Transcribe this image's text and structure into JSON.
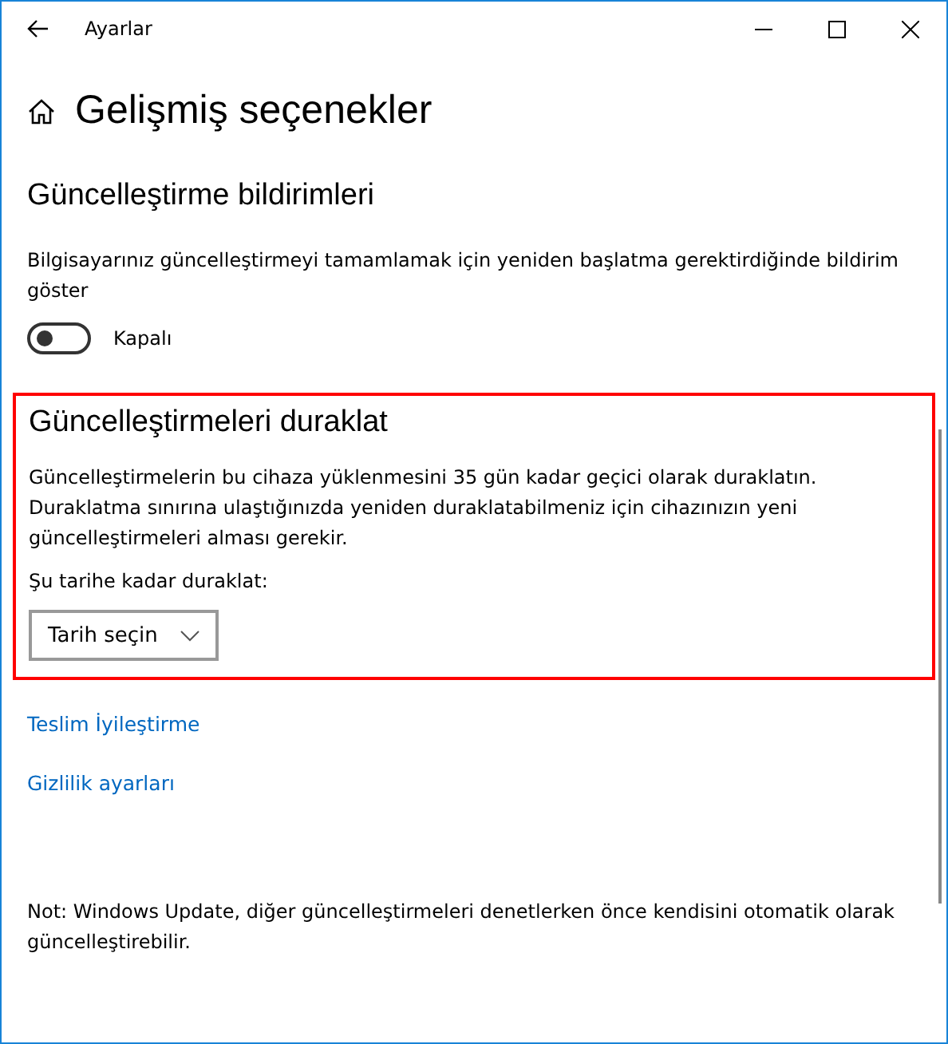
{
  "window": {
    "title": "Ayarlar"
  },
  "page_title": "Gelişmiş seçenekler",
  "notifications": {
    "heading": "Güncelleştirme bildirimleri",
    "description": "Bilgisayarınız güncelleştirmeyi tamamlamak için yeniden başlatma gerektirdiğinde bildirim göster",
    "toggle": {
      "on": false,
      "label": "Kapalı"
    }
  },
  "pause": {
    "highlighted": true,
    "heading": "Güncelleştirmeleri duraklat",
    "description": "Güncelleştirmelerin bu cihaza yüklenmesini 35 gün kadar geçici olarak duraklatın. Duraklatma sınırına ulaştığınızda yeniden duraklatabilmeniz için cihazınızın yeni güncelleştirmeleri alması gerekir.",
    "date_label": "Şu tarihe kadar duraklat:",
    "date_select": {
      "value": "Tarih seçin"
    }
  },
  "links": [
    "Teslim İyileştirme",
    "Gizlilik ayarları"
  ],
  "note": "Not: Windows Update, diğer güncelleştirmeleri denetlerken önce kendisini otomatik olarak güncelleştirebilir."
}
